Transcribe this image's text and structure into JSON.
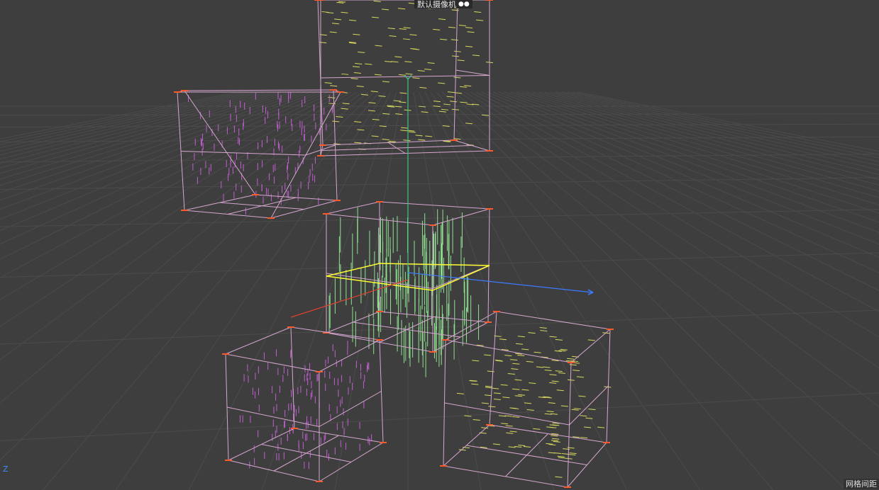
{
  "viewport": {
    "camera_label": "默认摄像机",
    "camera_icon": "camera-icon",
    "axis_indicator": "Z",
    "grid_spacing_label": "网格间距"
  },
  "colors": {
    "background": "#3e3e3e",
    "grid": "#4b4b4b",
    "box_wire": "#d6a6d0",
    "box_corner": "#ff5a2a",
    "selection": "#ffff33",
    "axis_x": "#e04030",
    "axis_y": "#40c080",
    "axis_z": "#3d7bff",
    "particles_purple": "#c060d0",
    "particles_yellow": "#d8d860",
    "particles_green": "#90e090"
  }
}
